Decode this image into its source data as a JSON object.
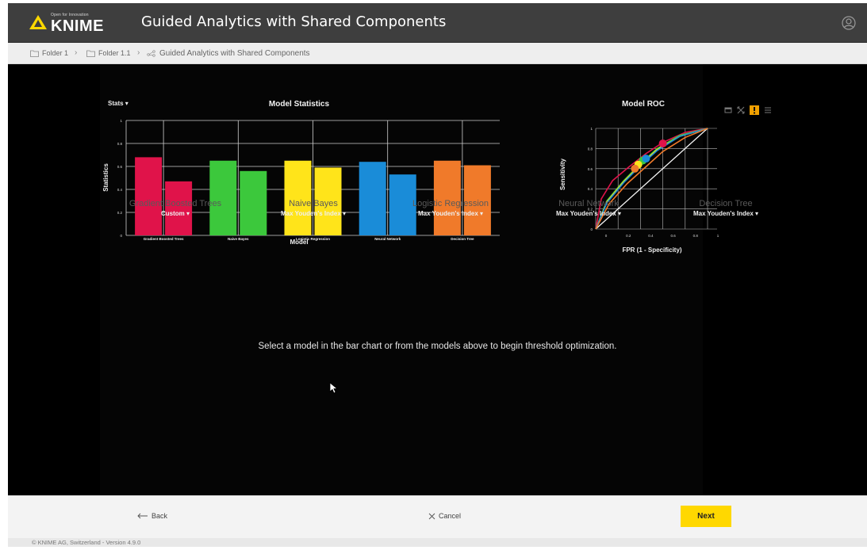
{
  "app": {
    "title": "Guided Analytics with Shared Components",
    "logo_tag": "Open for Innovation",
    "logo_word": "KNIME"
  },
  "breadcrumb": {
    "items": [
      "Folder 1",
      "Folder 1.1",
      "Guided Analytics with Shared Components"
    ]
  },
  "icons": {
    "user": "user-circle-icon",
    "folder": "folder-icon",
    "workflow": "workflow-icon",
    "back": "arrow-left-icon",
    "cancel": "close-icon",
    "cursor": "mouse-pointer-icon"
  },
  "stats_dropdown": "Stats ▾",
  "chart_data": [
    {
      "type": "bar",
      "title": "Model Statistics",
      "xlabel": "Model",
      "ylabel": "Statistics",
      "ylim": [
        0,
        1
      ],
      "yticks": [
        "0",
        "0.2",
        "0.4",
        "0.6",
        "0.8",
        "1"
      ],
      "categories": [
        "Gradient Boosted Trees",
        "Naive Bayes",
        "Logistic Regression",
        "Neural Network",
        "Decision Tree"
      ],
      "colors": [
        "#e0134a",
        "#3cc83c",
        "#ffe41a",
        "#1a8cd8",
        "#f07a2a"
      ],
      "series": [
        {
          "values": [
            0.68,
            0.65,
            0.65,
            0.64,
            0.65
          ]
        },
        {
          "values": [
            0.47,
            0.56,
            0.59,
            0.53,
            0.61
          ]
        }
      ],
      "grid": true
    },
    {
      "type": "line",
      "title": "Model ROC",
      "xlabel": "FPR (1 - Specificity)",
      "ylabel": "Sensitivity",
      "xlim": [
        0,
        1
      ],
      "ylim": [
        0,
        1
      ],
      "xticks": [
        "0",
        "0.2",
        "0.4",
        "0.6",
        "0.8",
        "1"
      ],
      "yticks": [
        "0",
        "0.2",
        "0.4",
        "0.6",
        "0.8",
        "1"
      ],
      "grid": true,
      "diagonal_reference": true,
      "series": [
        {
          "color": "#e0134a",
          "x": [
            0,
            0.05,
            0.15,
            0.3,
            0.45,
            0.6,
            0.8,
            1
          ],
          "y": [
            0,
            0.3,
            0.48,
            0.62,
            0.75,
            0.86,
            0.96,
            1
          ]
        },
        {
          "color": "#3cc83c",
          "x": [
            0,
            0.1,
            0.25,
            0.4,
            0.55,
            0.75,
            1
          ],
          "y": [
            0,
            0.28,
            0.48,
            0.65,
            0.8,
            0.93,
            1
          ]
        },
        {
          "color": "#ffe41a",
          "x": [
            0,
            0.1,
            0.25,
            0.4,
            0.55,
            0.75,
            1
          ],
          "y": [
            0,
            0.27,
            0.47,
            0.64,
            0.79,
            0.92,
            1
          ]
        },
        {
          "color": "#1a8cd8",
          "x": [
            0,
            0.1,
            0.25,
            0.4,
            0.55,
            0.75,
            1
          ],
          "y": [
            0,
            0.26,
            0.46,
            0.63,
            0.78,
            0.92,
            1
          ]
        },
        {
          "color": "#f07a2a",
          "x": [
            0,
            0.12,
            0.28,
            0.45,
            0.6,
            0.8,
            1
          ],
          "y": [
            0,
            0.25,
            0.45,
            0.62,
            0.77,
            0.91,
            1
          ]
        }
      ],
      "markers": [
        {
          "color": "#e0134a",
          "x": 0.6,
          "y": 0.85
        },
        {
          "color": "#3cc83c",
          "x": 0.42,
          "y": 0.68
        },
        {
          "color": "#ffe41a",
          "x": 0.38,
          "y": 0.64
        },
        {
          "color": "#1a8cd8",
          "x": 0.45,
          "y": 0.7
        },
        {
          "color": "#f07a2a",
          "x": 0.35,
          "y": 0.6
        }
      ]
    }
  ],
  "models": [
    {
      "name": "Gradient Boosted Trees",
      "threshold": "Custom ▾"
    },
    {
      "name": "Naive Bayes",
      "threshold": "Max Youden's Index ▾"
    },
    {
      "name": "Logistic Regression",
      "threshold": "Max Youden's Index ▾"
    },
    {
      "name": "Neural Network",
      "threshold": "Max Youden's Index ▾"
    },
    {
      "name": "Decision Tree",
      "threshold": "Max Youden's Index ▾"
    }
  ],
  "prompt": "Select a model in the bar chart or from the models above to begin threshold optimization.",
  "footer": {
    "back": "Back",
    "cancel": "Cancel",
    "next": "Next"
  },
  "copyright": "© KNIME AG, Switzerland - Version 4.9.0"
}
